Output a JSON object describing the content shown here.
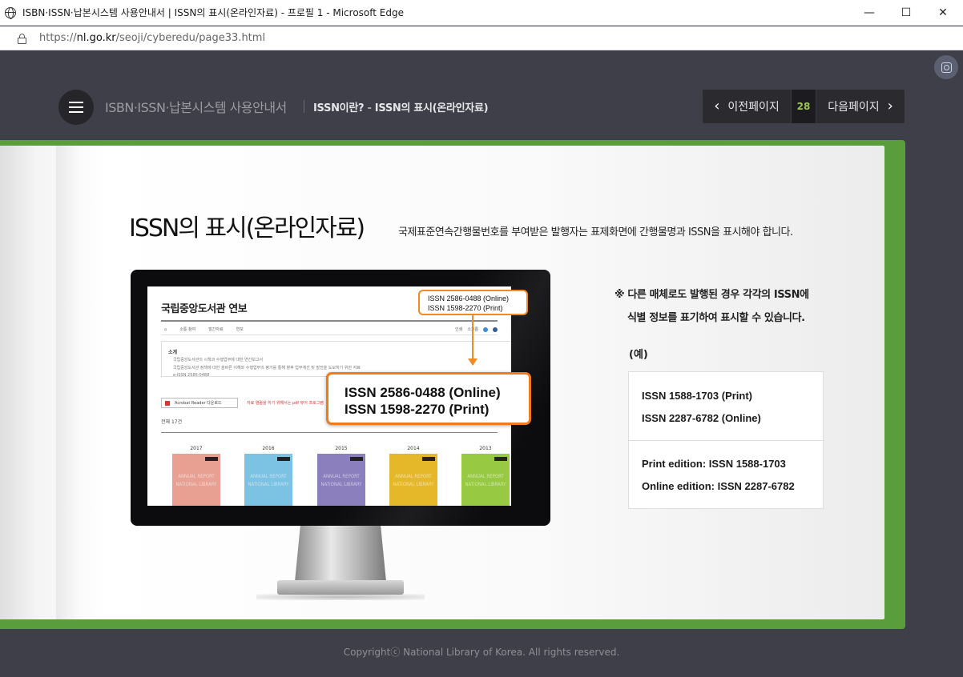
{
  "browser": {
    "window_title": "ISBN·ISSN·납본시스템 사용안내서 | ISSN의 표시(온라인자료) - 프로필 1 - Microsoft Edge",
    "url_prefix": "https://",
    "url_host": "nl.go.kr",
    "url_path": "/seoji/cyberedu/page33.html",
    "minimize": "—",
    "maximize": "☐",
    "close": "✕"
  },
  "header": {
    "site_title": "ISBN·ISSN·납본시스템 사용안내서",
    "breadcrumb_parent": "ISSN이란?",
    "breadcrumb_sep": " - ",
    "breadcrumb_current": "ISSN의 표시(온라인자료)"
  },
  "pager": {
    "prev_label": "이전페이지",
    "page_number": "28",
    "next_label": "다음페이지"
  },
  "content": {
    "heading": "ISSN의 표시(온라인자료)",
    "description": "국제표준연속간행물번호를 부여받은 발행자는 표제화면에 간행물명과 ISSN을 표시해야 합니다.",
    "note_line1": "※ 다른 매체로도 발행된 경우 각각의 ISSN에",
    "note_line2": "식별 정보를 표기하여 표시할 수 있습니다.",
    "example_label": "(예)",
    "example_rows": [
      "ISSN 1588-1703 (Print)",
      "ISSN 2287-6782 (Online)",
      "Print edition: ISSN 1588-1703",
      "Online edition: ISSN 2287-6782"
    ]
  },
  "screen": {
    "title": "국립중앙도서관 연보",
    "nav": [
      "소통 참여",
      "발간자료",
      "연보"
    ],
    "nav_right": [
      "인쇄",
      "소크롭"
    ],
    "box_head": "소개",
    "box_lines": [
      "국립중앙도서관의 시책과 수행업무에 대한 연간보고서",
      "국립중앙도서관 정책에 대한 올바른 이해와 수행업무의 평가를 통해 향후 업무계선 및 발전을 도모하기 위한 자료",
      "e-ISSN 2586-0488"
    ],
    "acrobat": "Acrobat Reader 다운로드",
    "red_notice": "자료 열람을 하기 위해서는 pdf 뷰어 프로그램",
    "count": "전체 17건",
    "years": [
      "2017",
      "2016",
      "2015",
      "2014",
      "2013"
    ],
    "report_text": "ANNUAL REPORT NATIONAL LIBRARY",
    "issn_online": "ISSN 2586-0488 (Online)",
    "issn_print": "ISSN 1598-2270 (Print)"
  },
  "footer": {
    "copyright": "Copyrightⓒ National Library of Korea. All rights reserved."
  },
  "colors": {
    "accent_orange": "#f07a1c",
    "book_green": "#5a9d3d",
    "page_number_green": "#9ec84f",
    "background": "#3e3f48"
  }
}
